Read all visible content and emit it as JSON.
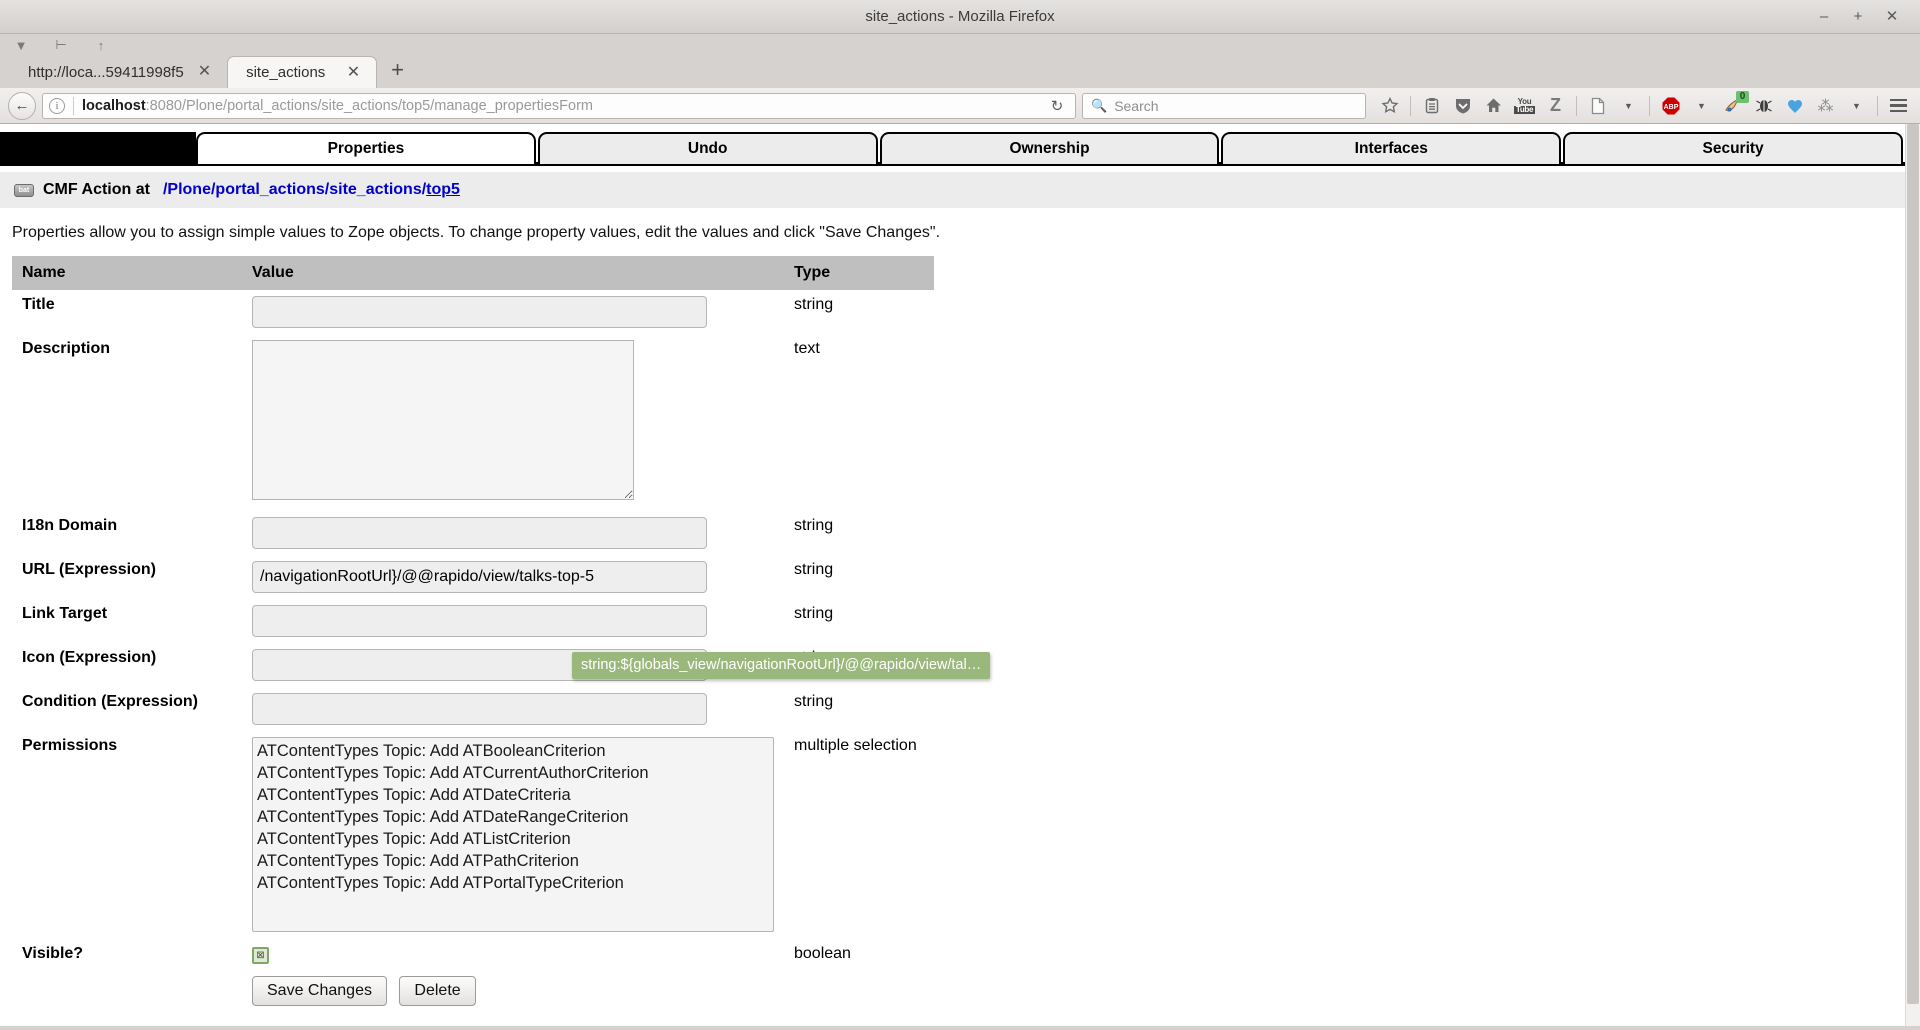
{
  "window": {
    "title": "site_actions - Mozilla Firefox",
    "controls": {
      "minimize": "–",
      "maximize": "+",
      "close": "✕"
    }
  },
  "tabstrip": {
    "tools": [
      "chevron-down",
      "list-all-tabs",
      "scroll-up"
    ],
    "tabs": [
      {
        "label": "http://loca...59411998f5",
        "active": false,
        "close": "✕"
      },
      {
        "label": "site_actions",
        "active": true,
        "close": "✕"
      }
    ],
    "new_tab": "+"
  },
  "navbar": {
    "back": "←",
    "url_host": "localhost",
    "url_rest": ":8080/Plone/portal_actions/site_actions/top5/manage_propertiesForm",
    "reload": "↻",
    "search_placeholder": "Search",
    "icons": [
      {
        "name": "bookmark-star-icon",
        "glyph": "☆"
      },
      {
        "name": "reading-list-icon",
        "glyph": "☰"
      },
      {
        "name": "downloads-icon",
        "glyph": "⬇"
      },
      {
        "name": "home-icon",
        "glyph": "⌂"
      },
      {
        "name": "youtube-icon",
        "glyph": "You"
      },
      {
        "name": "zotero-icon",
        "glyph": "Z"
      },
      {
        "name": "page-save-icon",
        "glyph": "▤"
      },
      {
        "name": "adblock-plus-icon",
        "glyph": "ABP"
      },
      {
        "name": "noscript-icon",
        "glyph": "⛳",
        "badge": "0"
      },
      {
        "name": "firebug-icon",
        "glyph": "◆"
      },
      {
        "name": "violentmonkey-icon",
        "glyph": "♥"
      },
      {
        "name": "greasemonkey-icon",
        "glyph": "⁂"
      },
      {
        "name": "menu-hamburger-icon",
        "glyph": "☰"
      }
    ]
  },
  "zmi": {
    "tabs": [
      {
        "label": "Properties",
        "active": true
      },
      {
        "label": "Undo",
        "active": false
      },
      {
        "label": "Ownership",
        "active": false
      },
      {
        "label": "Interfaces",
        "active": false
      },
      {
        "label": "Security",
        "active": false
      }
    ],
    "breadcrumb": {
      "icon_label": "bat",
      "label": "CMF Action at",
      "segments": [
        "Plone",
        "portal_actions",
        "site_actions",
        "top5"
      ]
    },
    "intro": "Properties allow you to assign simple values to Zope objects. To change property values, edit the values and click \"Save Changes\".",
    "table": {
      "headers": {
        "name": "Name",
        "value": "Value",
        "type": "Type"
      },
      "rows": [
        {
          "name": "Title",
          "type": "string",
          "control": "text",
          "value": ""
        },
        {
          "name": "Description",
          "type": "text",
          "control": "textarea",
          "value": ""
        },
        {
          "name": "I18n Domain",
          "type": "string",
          "control": "text",
          "value": ""
        },
        {
          "name": "URL (Expression)",
          "type": "string",
          "control": "text",
          "value": "/navigationRootUrl}/@@rapido/view/talks-top-5"
        },
        {
          "name": "Link Target",
          "type": "string",
          "control": "text",
          "value": ""
        },
        {
          "name": "Icon (Expression)",
          "type": "string",
          "control": "text",
          "value": ""
        },
        {
          "name": "Condition (Expression)",
          "type": "string",
          "control": "text",
          "value": ""
        },
        {
          "name": "Permissions",
          "type": "multiple selection",
          "control": "select",
          "value": ""
        },
        {
          "name": "Visible?",
          "type": "boolean",
          "control": "checkbox",
          "value": "checked"
        }
      ]
    },
    "permissions_options": [
      "ATContentTypes Topic: Add ATBooleanCriterion",
      "ATContentTypes Topic: Add ATCurrentAuthorCriterion",
      "ATContentTypes Topic: Add ATDateCriteria",
      "ATContentTypes Topic: Add ATDateRangeCriterion",
      "ATContentTypes Topic: Add ATListCriterion",
      "ATContentTypes Topic: Add ATPathCriterion",
      "ATContentTypes Topic: Add ATPortalTypeCriterion"
    ],
    "checkbox_glyph": "⊠",
    "buttons": {
      "save": "Save Changes",
      "delete": "Delete"
    },
    "tooltip": "string:${globals_view/navigationRootUrl}/@@rapido/view/tal…"
  },
  "colors": {
    "tab_active_bg": "#ffffff",
    "tooltip_bg": "#9bb87c",
    "link": "#0000cc",
    "table_header_bg": "#bfbfbf",
    "checkbox_border": "#7fa868"
  }
}
